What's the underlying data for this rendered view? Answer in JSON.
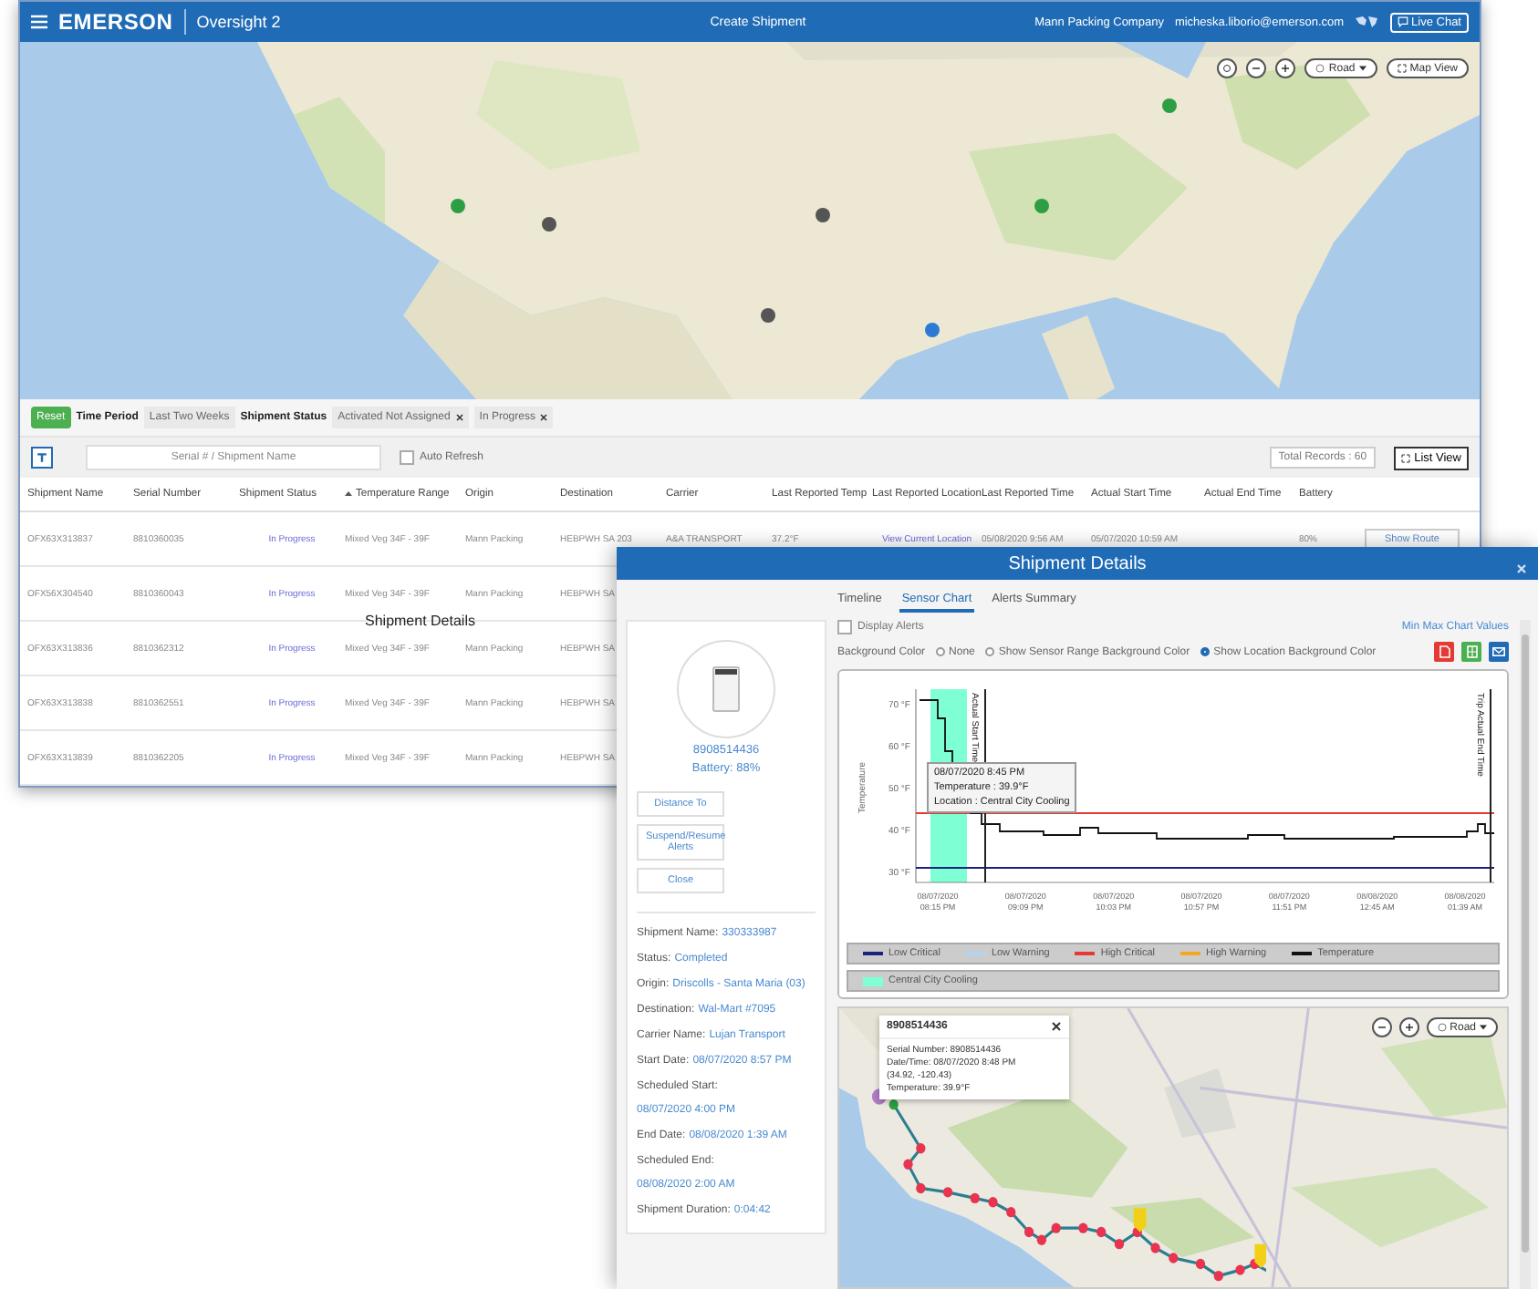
{
  "main_window": {
    "header": {
      "logo": "EMERSON",
      "product": "Oversight 2",
      "title": "Create Shipment",
      "company": "Mann Packing Company",
      "user": "micheska.liborio@emerson.com",
      "live_chat": "Live Chat"
    },
    "map": {
      "kind": "picture",
      "road": "Road",
      "map_view": "Map View"
    },
    "filters": {
      "reset": "Reset",
      "time_period_label": "Time Period",
      "time_period": "Last Two Weeks",
      "status_label": "Shipment Status",
      "chips": [
        "Activated Not Assigned",
        "In Progress"
      ]
    },
    "search": {
      "placeholder": "Serial # / Shipment Name",
      "auto_refresh": {
        "label": "Auto Refresh",
        "checked": false
      },
      "total_records": "Total Records : 60",
      "list_view": "List View"
    },
    "table": {
      "columns": [
        {
          "label": "Shipment Name",
          "kind": "text",
          "sorted": false
        },
        {
          "label": "Serial Number",
          "kind": "text",
          "sorted": false
        },
        {
          "label": "Shipment Status",
          "kind": "link",
          "sorted": false
        },
        {
          "label": "Temperature Range",
          "kind": "text",
          "sorted": true
        },
        {
          "label": "Origin",
          "kind": "text",
          "sorted": false
        },
        {
          "label": "Destination",
          "kind": "text",
          "sorted": false
        },
        {
          "label": "Carrier",
          "kind": "text",
          "sorted": false
        },
        {
          "label": "Last Reported Temp",
          "kind": "text",
          "sorted": false
        },
        {
          "label": "Last Reported Location",
          "kind": "link",
          "sorted": false
        },
        {
          "label": "Last Reported Time",
          "kind": "text",
          "sorted": false
        },
        {
          "label": "Actual Start Time",
          "kind": "text",
          "sorted": false
        },
        {
          "label": "Actual End Time",
          "sorted": false
        },
        {
          "label": "Battery",
          "kind": "text",
          "sorted": false
        }
      ],
      "rows": [
        {
          "cells": [
            "OFX63X313837",
            "8810360035",
            "In Progress",
            "Mixed Veg 34F - 39F",
            "Mann Packing",
            "HEBPWH SA 203",
            "A&A TRANSPORT",
            "37.2°F",
            "View Current Location",
            "05/08/2020 9:56 AM",
            "05/07/2020 10:59 AM",
            null,
            "80%"
          ],
          "actions": [
            "Show Route"
          ]
        },
        {
          "cells": [
            "OFX56X304540",
            "8810360043",
            "In Progress",
            "Mixed Veg 34F - 39F",
            "Mann Packing",
            "HEBPWH SA"
          ]
        },
        {
          "cells": [
            "OFX63X313836",
            "8810362312",
            "In Progress",
            "Mixed Veg 34F - 39F",
            "Mann Packing",
            "HEBPWH SA"
          ]
        },
        {
          "cells": [
            "OFX63X313838",
            "8810362551",
            "In Progress",
            "Mixed Veg 34F - 39F",
            "Mann Packing",
            "HEBPWH SA"
          ]
        },
        {
          "cells": [
            "OFX63X313839",
            "8810362205",
            "In Progress",
            "Mixed Veg 34F - 39F",
            "Mann Packing",
            "HEBPWH SA"
          ]
        }
      ]
    },
    "overlay_text": "Shipment Details"
  },
  "dialog": {
    "title": "Shipment Details",
    "tabs": [
      {
        "label": "Timeline",
        "selected": false
      },
      {
        "label": "Sensor Chart",
        "selected": true
      },
      {
        "label": "Alerts Summary",
        "selected": false
      }
    ],
    "device": {
      "serial": "8908514436",
      "battery": "Battery: 88%"
    },
    "buttons": [
      "Distance To",
      "Suspend/Resume Alerts",
      "Close"
    ],
    "details": [
      {
        "label": "Shipment Name:",
        "value": "330333987"
      },
      {
        "label": "Status:",
        "value": "Completed"
      },
      {
        "label": "Origin:",
        "value": "Driscolls - Santa Maria (03)"
      },
      {
        "label": "Destination:",
        "value": "Wal-Mart #7095"
      },
      {
        "label": "Carrier Name:",
        "value": "Lujan Transport"
      },
      {
        "label": "Start Date:",
        "value": "08/07/2020 8:57 PM"
      },
      {
        "label": "Scheduled Start:",
        "value": "08/07/2020 4:00 PM"
      },
      {
        "label": "End Date:",
        "value": "08/08/2020 1:39 AM"
      },
      {
        "label": "Scheduled End:",
        "value": "08/08/2020 2:00 AM"
      },
      {
        "label": "Shipment Duration:",
        "value": "0:04:42"
      }
    ],
    "display_alerts": {
      "label": "Display Alerts",
      "checked": false
    },
    "min_max_link": "Min Max Chart Values",
    "background_color": {
      "label": "Background Color",
      "options": [
        {
          "label": "None",
          "selected": false
        },
        {
          "label": "Show Sensor Range Background Color",
          "selected": false
        },
        {
          "label": "Show Location Background Color",
          "selected": true
        }
      ]
    },
    "chart": {
      "ylabel": "Temperature",
      "yticks": [
        "70 °F",
        "60 °F",
        "50 °F",
        "40 °F",
        "30 °F"
      ],
      "xticks": [
        [
          "08/07/2020",
          "08:15 PM"
        ],
        [
          "08/07/2020",
          "09:09 PM"
        ],
        [
          "08/07/2020",
          "10:03 PM"
        ],
        [
          "08/07/2020",
          "10:57 PM"
        ],
        [
          "08/07/2020",
          "11:51 PM"
        ],
        [
          "08/08/2020",
          "12:45 AM"
        ],
        [
          "08/08/2020",
          "01:39 AM"
        ]
      ],
      "markers": [
        "Actual Start Time",
        "Trip Actual End Time"
      ],
      "tooltip": [
        "08/07/2020 8:45 PM",
        "Temperature : 39.9°F",
        "Location : Central City Cooling"
      ],
      "legend": [
        {
          "label": "Low Critical",
          "color": "#1a237e"
        },
        {
          "label": "Low Warning",
          "color": "#b3d4f0"
        },
        {
          "label": "High Critical",
          "color": "#e53935"
        },
        {
          "label": "High Warning",
          "color": "#f5a623"
        },
        {
          "label": "Temperature",
          "color": "#111111"
        }
      ],
      "locations": [
        {
          "label": "Central City Cooling",
          "color": "#7fffd4"
        }
      ]
    },
    "map": {
      "kind": "picture",
      "road": "Road",
      "popup": {
        "title": "8908514436",
        "lines": [
          "Serial Number: 8908514436",
          "Date/Time: 08/07/2020 8:48 PM",
          "(34.92, -120.43)",
          "Temperature:  39.9°F"
        ]
      }
    }
  }
}
